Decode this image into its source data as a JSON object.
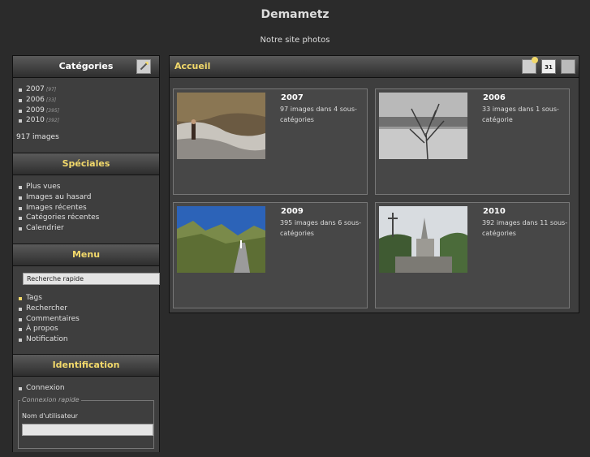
{
  "site": {
    "title": "Demametz",
    "subtitle": "Notre site photos"
  },
  "categories_block": {
    "title": "Catégories",
    "items": [
      {
        "label": "2007",
        "count": "[97]"
      },
      {
        "label": "2006",
        "count": "[33]"
      },
      {
        "label": "2009",
        "count": "[395]"
      },
      {
        "label": "2010",
        "count": "[392]"
      }
    ],
    "total": "917 images"
  },
  "specials_block": {
    "title": "Spéciales",
    "items": [
      "Plus vues",
      "Images au hasard",
      "Images récentes",
      "Catégories récentes",
      "Calendrier"
    ]
  },
  "menu_block": {
    "title": "Menu",
    "quick_search": "Recherche rapide",
    "items": [
      "Tags",
      "Rechercher",
      "Commentaires",
      "À propos",
      "Notification"
    ]
  },
  "identification_block": {
    "title": "Identification",
    "items": [
      "Connexion"
    ],
    "quick_connect_legend": "Connexion rapide",
    "username_label": "Nom d'utilisateur"
  },
  "content": {
    "breadcrumb": "Accueil",
    "calendar_icon_text": "31",
    "categories": [
      {
        "title": "2007",
        "description": "97 images dans 4 sous-catégories"
      },
      {
        "title": "2006",
        "description": "33 images dans 1 sous-catégorie"
      },
      {
        "title": "2009",
        "description": "395 images dans 6 sous-catégories"
      },
      {
        "title": "2010",
        "description": "392 images dans 11 sous-catégories"
      }
    ]
  },
  "colors": {
    "accent": "#f2d96b",
    "background": "#2b2b2b",
    "panel": "#3e3e3e"
  }
}
